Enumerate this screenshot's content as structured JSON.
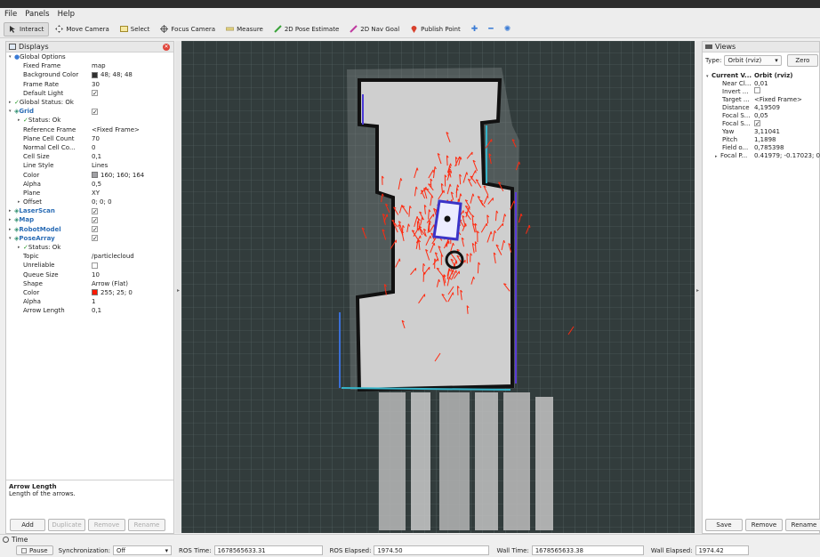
{
  "menubar": {
    "items": [
      {
        "label": "File"
      },
      {
        "label": "Panels"
      },
      {
        "label": "Help"
      }
    ]
  },
  "toolbar": {
    "tools": [
      {
        "label": "Interact",
        "icon": "cursor-icon",
        "active": true
      },
      {
        "label": "Move Camera",
        "icon": "move-camera-icon"
      },
      {
        "label": "Select",
        "icon": "select-icon"
      },
      {
        "label": "Focus Camera",
        "icon": "focus-camera-icon"
      },
      {
        "label": "Measure",
        "icon": "measure-icon"
      },
      {
        "label": "2D Pose Estimate",
        "icon": "pose-estimate-icon",
        "color": "#3aa33a"
      },
      {
        "label": "2D Nav Goal",
        "icon": "nav-goal-icon",
        "color": "#c03aa0"
      },
      {
        "label": "Publish Point",
        "icon": "publish-point-icon",
        "color": "#d8402c"
      }
    ],
    "extra_icons": [
      "add-tool-icon",
      "remove-tool-icon",
      "camera-type-icon"
    ]
  },
  "displays": {
    "title": "Displays",
    "rows": [
      {
        "k": "Global Options",
        "v": "",
        "level": 0,
        "arrow": "down",
        "icon": "gear"
      },
      {
        "k": "Fixed Frame",
        "v": "map",
        "level": 1
      },
      {
        "k": "Background Color",
        "v": "48; 48; 48",
        "level": 1,
        "swatch": "#303030"
      },
      {
        "k": "Frame Rate",
        "v": "30",
        "level": 1
      },
      {
        "k": "Default Light",
        "v": "",
        "level": 1,
        "check": true
      },
      {
        "k": "Global Status: Ok",
        "v": "",
        "level": 0,
        "arrow": "right",
        "ok": true
      },
      {
        "k": "Grid",
        "v": "",
        "level": 0,
        "arrow": "down",
        "blue": true,
        "check": true
      },
      {
        "k": "Status: Ok",
        "v": "",
        "level": 1,
        "arrow": "right",
        "ok": true
      },
      {
        "k": "Reference Frame",
        "v": "<Fixed Frame>",
        "level": 1
      },
      {
        "k": "Plane Cell Count",
        "v": "70",
        "level": 1
      },
      {
        "k": "Normal Cell Co...",
        "v": "0",
        "level": 1
      },
      {
        "k": "Cell Size",
        "v": "0,1",
        "level": 1
      },
      {
        "k": "Line Style",
        "v": "Lines",
        "level": 1
      },
      {
        "k": "Color",
        "v": "160; 160; 164",
        "level": 1,
        "swatch": "#a0a0a4"
      },
      {
        "k": "Alpha",
        "v": "0,5",
        "level": 1
      },
      {
        "k": "Plane",
        "v": "XY",
        "level": 1
      },
      {
        "k": "Offset",
        "v": "0; 0; 0",
        "level": 1,
        "arrow": "right"
      },
      {
        "k": "LaserScan",
        "v": "",
        "level": 0,
        "arrow": "right",
        "blue": true,
        "check": true
      },
      {
        "k": "Map",
        "v": "",
        "level": 0,
        "arrow": "right",
        "blue": true,
        "check": true
      },
      {
        "k": "RobotModel",
        "v": "",
        "level": 0,
        "arrow": "right",
        "blue": true,
        "check": true
      },
      {
        "k": "PoseArray",
        "v": "",
        "level": 0,
        "arrow": "down",
        "blue": true,
        "check": true
      },
      {
        "k": "Status: Ok",
        "v": "",
        "level": 1,
        "arrow": "right",
        "ok": true
      },
      {
        "k": "Topic",
        "v": "/particlecloud",
        "level": 1
      },
      {
        "k": "Unreliable",
        "v": "",
        "level": 1,
        "check": false
      },
      {
        "k": "Queue Size",
        "v": "10",
        "level": 1
      },
      {
        "k": "Shape",
        "v": "Arrow (Flat)",
        "level": 1
      },
      {
        "k": "Color",
        "v": "255; 25; 0",
        "level": 1,
        "swatch": "#ff1900"
      },
      {
        "k": "Alpha",
        "v": "1",
        "level": 1
      },
      {
        "k": "Arrow Length",
        "v": "0,1",
        "level": 1
      }
    ],
    "desc_title": "Arrow Length",
    "desc_text": "Length of the arrows.",
    "buttons": [
      {
        "label": "Add",
        "enabled": true
      },
      {
        "label": "Duplicate",
        "enabled": false
      },
      {
        "label": "Remove",
        "enabled": false
      },
      {
        "label": "Rename",
        "enabled": false
      }
    ]
  },
  "views": {
    "title": "Views",
    "type_label": "Type:",
    "type_value": "Orbit (rviz)",
    "zero_label": "Zero",
    "rows": [
      {
        "k": "Current V...",
        "v": "Orbit (rviz)",
        "bold": true,
        "arrow": "down"
      },
      {
        "k": "Near Cl...",
        "v": "0,01"
      },
      {
        "k": "Invert ...",
        "v": "",
        "check": false
      },
      {
        "k": "Target ...",
        "v": "<Fixed Frame>"
      },
      {
        "k": "Distance",
        "v": "4,19509"
      },
      {
        "k": "Focal S...",
        "v": "0,05"
      },
      {
        "k": "Focal S...",
        "v": "",
        "check": true
      },
      {
        "k": "Yaw",
        "v": "3,11041"
      },
      {
        "k": "Pitch",
        "v": "1,1898"
      },
      {
        "k": "Field o...",
        "v": "0,785398"
      },
      {
        "k": "Focal P...",
        "v": "0.41979; -0.17023; 0",
        "arrow": "right"
      }
    ],
    "buttons": [
      {
        "label": "Save"
      },
      {
        "label": "Remove"
      },
      {
        "label": "Rename"
      }
    ]
  },
  "time": {
    "title": "Time",
    "pause_label": "Pause",
    "sync_label": "Synchronization:",
    "sync_value": "Off",
    "ros_time_label": "ROS Time:",
    "ros_time": "1678565633.31",
    "ros_elapsed_label": "ROS Elapsed:",
    "ros_elapsed": "1974.50",
    "wall_time_label": "Wall Time:",
    "wall_time": "1678565633.38",
    "wall_elapsed_label": "Wall Elapsed:",
    "wall_elapsed": "1974.42"
  },
  "colors": {
    "viewport_bg": "#303030",
    "grid": "#a0a0a4",
    "particles": "#ff1900",
    "map_free": "#cdcdcd",
    "accent": "#2a6cb5"
  }
}
